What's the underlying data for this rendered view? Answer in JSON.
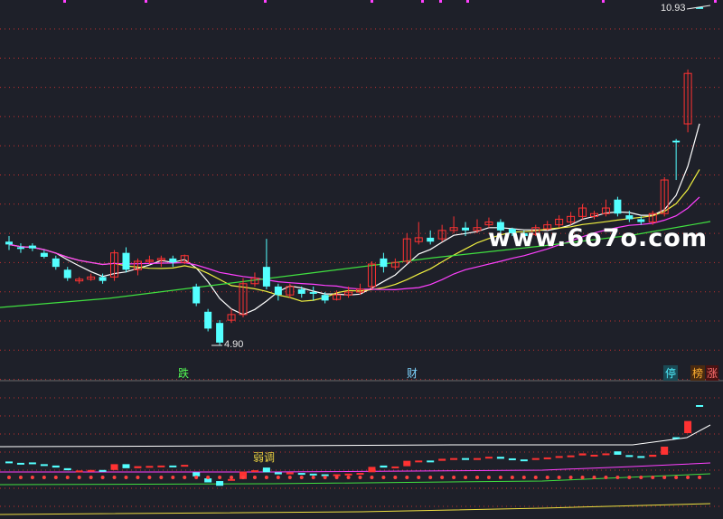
{
  "watermark": "www.6o7o.com",
  "high_label": "10.93",
  "low_label": "4.90",
  "annotations": {
    "die": "跌",
    "cai": "财",
    "ting": "停",
    "bang": "榜",
    "zhang": "涨"
  },
  "sub_label": "弱调",
  "colors": {
    "background": "#1e2029",
    "up": "#ff3232",
    "down": "#54ffff",
    "ma_white": "#ffffff",
    "ma_yellow": "#f0f040",
    "ma_magenta": "#ff40ff",
    "ma_green": "#40e040"
  },
  "chart_data": {
    "type": "candlestick",
    "high": 10.93,
    "low": 4.9,
    "candles": [
      [
        6.75,
        6.7,
        6.85,
        6.6
      ],
      [
        6.65,
        6.62,
        6.72,
        6.55
      ],
      [
        6.68,
        6.63,
        6.72,
        6.58
      ],
      [
        6.55,
        6.48,
        6.6,
        6.45
      ],
      [
        6.45,
        6.3,
        6.5,
        6.25
      ],
      [
        6.25,
        6.1,
        6.3,
        6.05
      ],
      [
        6.05,
        6.08,
        6.12,
        6.0
      ],
      [
        6.08,
        6.12,
        6.18,
        6.05
      ],
      [
        6.12,
        6.05,
        6.18,
        6.0
      ],
      [
        6.12,
        6.55,
        6.6,
        6.05
      ],
      [
        6.55,
        6.25,
        6.65,
        6.2
      ],
      [
        6.25,
        6.4,
        6.45,
        6.15
      ],
      [
        6.4,
        6.42,
        6.5,
        6.35
      ],
      [
        6.42,
        6.45,
        6.5,
        6.3
      ],
      [
        6.45,
        6.38,
        6.5,
        6.3
      ],
      [
        6.38,
        6.5,
        6.52,
        6.35
      ],
      [
        5.95,
        5.65,
        6.0,
        5.6
      ],
      [
        5.5,
        5.2,
        5.55,
        5.15
      ],
      [
        5.3,
        4.95,
        5.35,
        4.9
      ],
      [
        5.35,
        5.45,
        5.55,
        5.3
      ],
      [
        5.45,
        6.0,
        6.1,
        5.4
      ],
      [
        6.0,
        6.1,
        6.2,
        5.95
      ],
      [
        6.3,
        5.95,
        6.8,
        5.9
      ],
      [
        5.95,
        5.8,
        6.0,
        5.7
      ],
      [
        5.8,
        5.95,
        6.0,
        5.75
      ],
      [
        5.9,
        5.82,
        5.95,
        5.75
      ],
      [
        5.85,
        5.82,
        5.95,
        5.7
      ],
      [
        5.8,
        5.7,
        5.85,
        5.65
      ],
      [
        5.72,
        5.8,
        5.88,
        5.7
      ],
      [
        5.8,
        5.85,
        5.95,
        5.75
      ],
      [
        5.85,
        5.9,
        6.0,
        5.8
      ],
      [
        5.95,
        6.35,
        6.4,
        5.9
      ],
      [
        6.45,
        6.3,
        6.55,
        6.2
      ],
      [
        6.3,
        6.38,
        6.45,
        6.25
      ],
      [
        6.4,
        6.8,
        6.9,
        6.35
      ],
      [
        6.75,
        6.82,
        7.1,
        6.7
      ],
      [
        6.82,
        6.75,
        6.95,
        6.7
      ],
      [
        6.8,
        6.95,
        7.05,
        6.75
      ],
      [
        6.95,
        7.0,
        7.2,
        6.9
      ],
      [
        7.0,
        6.95,
        7.1,
        6.85
      ],
      [
        6.95,
        7.0,
        7.15,
        6.9
      ],
      [
        7.05,
        7.1,
        7.18,
        7.0
      ],
      [
        7.1,
        6.95,
        7.15,
        6.9
      ],
      [
        6.98,
        6.9,
        7.0,
        6.85
      ],
      [
        6.9,
        6.85,
        6.95,
        6.8
      ],
      [
        6.88,
        7.0,
        7.05,
        6.85
      ],
      [
        6.98,
        7.05,
        7.12,
        6.95
      ],
      [
        7.05,
        7.15,
        7.22,
        7.0
      ],
      [
        7.1,
        7.2,
        7.28,
        7.05
      ],
      [
        7.2,
        7.35,
        7.42,
        7.15
      ],
      [
        7.2,
        7.25,
        7.3,
        7.15
      ],
      [
        7.25,
        7.35,
        7.5,
        7.2
      ],
      [
        7.5,
        7.25,
        7.55,
        7.2
      ],
      [
        7.22,
        7.15,
        7.3,
        7.1
      ],
      [
        7.15,
        7.1,
        7.2,
        7.05
      ],
      [
        7.1,
        7.25,
        7.3,
        7.05
      ],
      [
        7.25,
        7.85,
        7.9,
        7.2
      ],
      [
        8.55,
        8.52,
        8.58,
        7.85
      ],
      [
        8.85,
        9.75,
        9.82,
        8.7
      ],
      [
        10.93,
        10.9,
        10.93,
        10.93
      ]
    ],
    "sub_candles": [
      [
        6.75,
        6.7
      ],
      [
        6.65,
        6.62
      ],
      [
        6.68,
        6.63
      ],
      [
        6.55,
        6.48
      ],
      [
        6.45,
        6.3
      ],
      [
        6.25,
        6.1
      ],
      [
        6.05,
        6.08
      ],
      [
        6.08,
        6.12
      ],
      [
        6.12,
        6.05
      ],
      [
        6.12,
        6.55
      ],
      [
        6.55,
        6.25
      ],
      [
        6.25,
        6.4
      ],
      [
        6.4,
        6.42
      ],
      [
        6.42,
        6.45
      ],
      [
        6.45,
        6.38
      ],
      [
        6.38,
        6.5
      ],
      [
        5.95,
        5.65
      ],
      [
        5.5,
        5.2
      ],
      [
        5.3,
        4.95
      ],
      [
        5.35,
        5.45
      ],
      [
        5.45,
        6.0
      ],
      [
        6.0,
        6.1
      ],
      [
        6.3,
        5.95
      ],
      [
        5.95,
        5.8
      ],
      [
        5.8,
        5.95
      ],
      [
        5.9,
        5.82
      ],
      [
        5.85,
        5.82
      ],
      [
        5.8,
        5.7
      ],
      [
        5.72,
        5.8
      ],
      [
        5.8,
        5.85
      ],
      [
        5.85,
        5.9
      ],
      [
        5.95,
        6.35
      ],
      [
        6.45,
        6.3
      ],
      [
        6.3,
        6.38
      ],
      [
        6.4,
        6.8
      ],
      [
        6.75,
        6.82
      ],
      [
        6.82,
        6.75
      ],
      [
        6.8,
        6.95
      ],
      [
        6.95,
        7.0
      ],
      [
        7.0,
        6.95
      ],
      [
        6.95,
        7.0
      ],
      [
        7.05,
        7.1
      ],
      [
        7.1,
        6.95
      ],
      [
        6.98,
        6.9
      ],
      [
        6.9,
        6.85
      ],
      [
        6.88,
        7.0
      ],
      [
        6.98,
        7.05
      ],
      [
        7.05,
        7.15
      ],
      [
        7.1,
        7.2
      ],
      [
        7.2,
        7.35
      ],
      [
        7.2,
        7.25
      ],
      [
        7.25,
        7.35
      ],
      [
        7.5,
        7.25
      ],
      [
        7.22,
        7.15
      ],
      [
        7.15,
        7.1
      ],
      [
        7.1,
        7.25
      ],
      [
        7.25,
        7.85
      ],
      [
        8.55,
        8.52
      ],
      [
        8.85,
        9.75
      ],
      [
        10.93,
        10.9
      ]
    ]
  }
}
